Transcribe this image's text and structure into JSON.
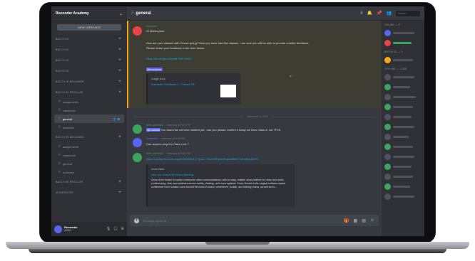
{
  "server": {
    "name": "Roocoder Academy",
    "new_unreads": "NEW UNREADS"
  },
  "channel": {
    "name": "general"
  },
  "sidebar": {
    "categories_top": [
      "BATCH 01",
      "BATCH 02",
      "BATCH 03",
      "BATCH 04",
      "BATCH 05 BEGINNER"
    ],
    "category_current": "BATCH 05 REGULAR",
    "channels_current": [
      "assignments",
      "classroom",
      "general",
      "schedule"
    ],
    "category_next": "BATCH 06 BEGINNER",
    "channels_next": [
      "assignments",
      "classroom",
      "general",
      "schedule"
    ],
    "categories_bottom": [
      "BATCH 06 REGULAR",
      "MODERATOR"
    ],
    "user": {
      "name": "Roocoder",
      "tag": "#0000"
    }
  },
  "messages": {
    "m1": {
      "author": "Roocoder",
      "greeting": "Hi @everyone,",
      "body1": "How are your classes with Franze going? Now you have had few classes, I am sure you will be able to provide a better feedback.",
      "body2": "Please share your feedback in the form below.",
      "link": "https://forms.gle/XNwvMTSRYWsH",
      "tag": "@everyone",
      "card_source": "Google Docs",
      "card_title": "Instructor Feedback 2 - Franze RL"
    },
    "date_divider": "November 4, 2022",
    "m2": {
      "author": "Arlm_user9332",
      "time": "Yesterday at 9:02 PM",
      "mention": "@roashok",
      "text": "the class has not been started yet.. can you please confirm if today we have class or not ?FYA"
    },
    "m3": {
      "author": "Jeffwitham",
      "time": "Yesterday at 9:06 PM",
      "text": "Can anyone ping the Class Link ?"
    },
    "m4": {
      "author": "Arlm_user9332",
      "time": "Yesterday at 9:08 PM",
      "link": "https://us06web.zoom.us/j/84323851437?pwd=YXlZeHFpcDZhcjloa0N4YXZmdkpUZz09",
      "card_source": "Zoom Video",
      "card_title": "Join our Cloud HD Video Meeting",
      "card_desc": "Zoom is the leader in modern enterprise video communications, with an easy, reliable cloud platform for video and audio conferencing, chat, and webinars across mobile, desktop, and room systems. Zoom Rooms is the original software-based conference room solution used around the world in board, conference, huddle, and training rooms, as well as ex..."
    }
  },
  "composer": {
    "placeholder": "Message #general"
  },
  "topbar": {
    "search_placeholder": "Search"
  },
  "members": {
    "group_online": "ONLINE — 6",
    "group_admin": "BATCH 05 — 2",
    "group_offline": "OFFLINE — 1,006"
  },
  "colors": {
    "accent": "#5865f2",
    "highlight_border": "#faa61a",
    "link": "#00b0f4",
    "online": "#3ba55c"
  }
}
